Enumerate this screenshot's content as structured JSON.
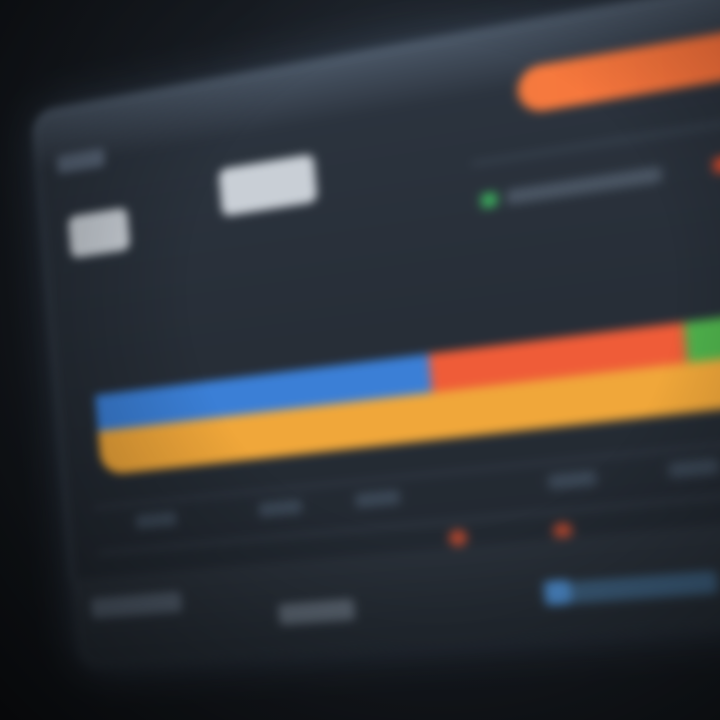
{
  "window": {
    "tag_label": "",
    "tile_a_label": "",
    "tile_b_label": ""
  },
  "header_bar": {
    "accent_color": "#f57a3e"
  },
  "legend": {
    "items": [
      {
        "icon": "green-square-icon",
        "color": "#3aa15a",
        "label": ""
      },
      {
        "icon": "red-square-icon",
        "color": "#d64a2c",
        "label": ""
      }
    ]
  },
  "stacked_bar": {
    "segments_top": [
      {
        "color": "#3b7fd6",
        "share": 0.44
      },
      {
        "color": "#ef5c38",
        "share": 0.3
      },
      {
        "color": "#4fb24c",
        "share": 0.26
      }
    ],
    "segments_bottom": [
      {
        "color": "#f0a73a",
        "share": 1.0
      }
    ]
  },
  "footer": {
    "button_1": "",
    "button_2": "",
    "button_3": "",
    "icon_1": "app-icon",
    "icon_2": "app-icon"
  },
  "colors": {
    "background": "#14181d",
    "panel": "#2a313a",
    "blue": "#3b7fd6",
    "red": "#ef5c38",
    "green": "#4fb24c",
    "yellow": "#f0a73a",
    "orange": "#f57a3e"
  }
}
